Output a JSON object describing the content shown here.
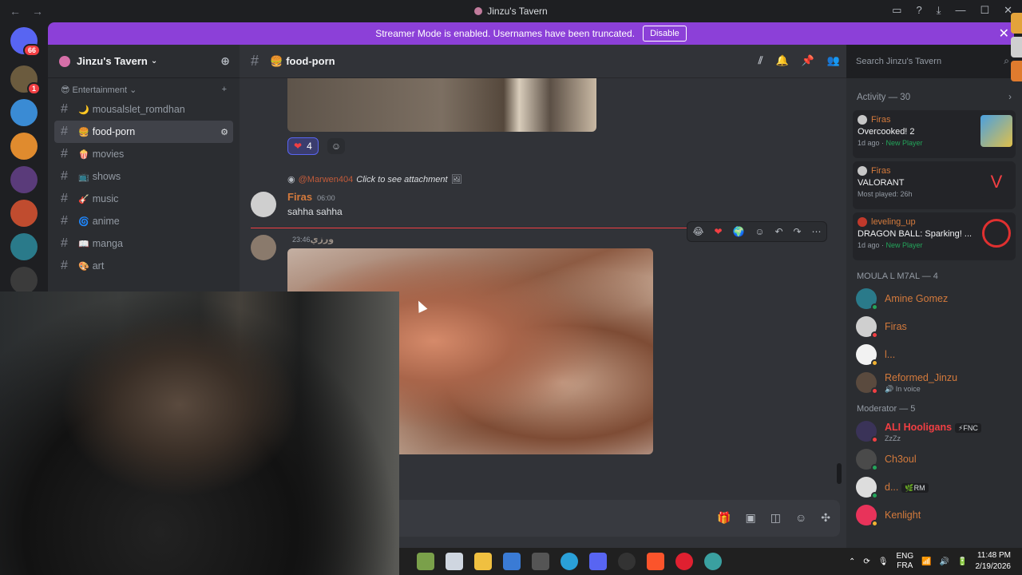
{
  "window": {
    "title": "Jinzu's Tavern",
    "nav_back": "←",
    "nav_forward": "→"
  },
  "servers": {
    "dm_badge": "66",
    "server_badge": "1"
  },
  "banner": {
    "text": "Streamer Mode is enabled. Usernames have been truncated.",
    "button": "Disable",
    "close": "✕"
  },
  "guild": {
    "name": "Jinzu's Tavern"
  },
  "category": {
    "label": "Entertainment"
  },
  "channels": [
    {
      "emoji": "🌙",
      "name": "mousalslet_romdhan"
    },
    {
      "emoji": "🍔",
      "name": "food-porn"
    },
    {
      "emoji": "🍿",
      "name": "movies"
    },
    {
      "emoji": "📺",
      "name": "shows"
    },
    {
      "emoji": "🎸",
      "name": "music"
    },
    {
      "emoji": "🌀",
      "name": "anime"
    },
    {
      "emoji": "📖",
      "name": "manga"
    },
    {
      "emoji": "🎨",
      "name": "art"
    }
  ],
  "channel_header": {
    "emoji": "🍔",
    "name": "food-porn"
  },
  "search": {
    "placeholder": "Search Jinzu's Tavern"
  },
  "messages": {
    "reaction_count": "4",
    "reply": {
      "name": "@Marwen404",
      "text": "Click to see attachment"
    },
    "msg1": {
      "author": "Firas",
      "time": "06:00",
      "text": "sahha sahha"
    },
    "msg2": {
      "author": "ورزي",
      "time": "23:46"
    }
  },
  "activity": {
    "header": "Activity — 30",
    "items": [
      {
        "user": "Firas",
        "game": "Overcooked! 2",
        "meta": "1d ago",
        "tag": "New Player"
      },
      {
        "user": "Firas",
        "game": "VALORANT",
        "meta": "Most played: 26h",
        "tag": ""
      },
      {
        "user": "leveling_up",
        "game": "DRAGON BALL: Sparking! ...",
        "meta": "1d ago",
        "tag": "New Player"
      }
    ]
  },
  "groups": {
    "moula": {
      "label": "MOULA L M7AL — 4",
      "members": [
        {
          "name": "Amine Gomez",
          "sub": ""
        },
        {
          "name": "Firas",
          "sub": ""
        },
        {
          "name": "l...",
          "sub": ""
        },
        {
          "name": "Reformed_Jinzu",
          "sub": "In voice"
        }
      ]
    },
    "moderator": {
      "label": "Moderator — 5",
      "members": [
        {
          "name": "ALI Hooligans",
          "sub": "ZzZz",
          "tag": "FNC"
        },
        {
          "name": "Ch3oul",
          "sub": ""
        },
        {
          "name": "d...",
          "sub": "",
          "tag": "RM"
        },
        {
          "name": "Kenlight",
          "sub": ""
        }
      ]
    }
  },
  "taskbar": {
    "lang1": "ENG",
    "lang2": "FRA",
    "time": "11:48 PM",
    "date": "2/19/2026"
  }
}
